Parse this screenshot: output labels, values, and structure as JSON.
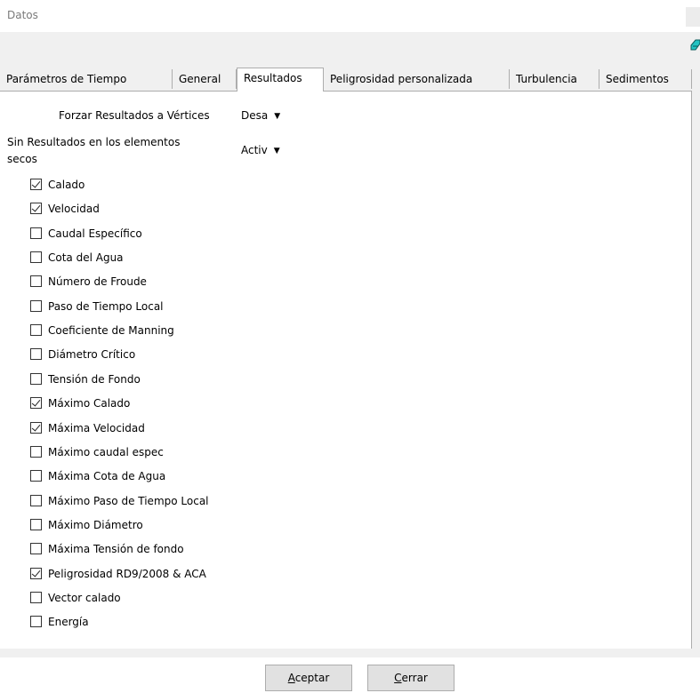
{
  "window": {
    "title": "Datos"
  },
  "tabs": [
    {
      "label": "Parámetros de Tiempo",
      "active": false
    },
    {
      "label": "General",
      "active": false
    },
    {
      "label": "Resultados",
      "active": true
    },
    {
      "label": "Peligrosidad personalizada",
      "active": false
    },
    {
      "label": "Turbulencia",
      "active": false
    },
    {
      "label": "Sedimentos",
      "active": false
    }
  ],
  "settings": {
    "force_label": "Forzar Resultados a Vértices",
    "force_value": "Desa",
    "dry_label_line1": "Sin Resultados en los elementos",
    "dry_label_line2": "secos",
    "dry_value": "Activ"
  },
  "results": [
    {
      "label": "Calado",
      "checked": true
    },
    {
      "label": "Velocidad",
      "checked": true
    },
    {
      "label": "Caudal Específico",
      "checked": false
    },
    {
      "label": "Cota del Agua",
      "checked": false
    },
    {
      "label": "Número de Froude",
      "checked": false
    },
    {
      "label": "Paso de Tiempo Local",
      "checked": false
    },
    {
      "label": "Coeficiente de Manning",
      "checked": false
    },
    {
      "label": "Diámetro Crítico",
      "checked": false
    },
    {
      "label": "Tensión de Fondo",
      "checked": false
    },
    {
      "label": "Máximo Calado",
      "checked": true
    },
    {
      "label": "Máxima Velocidad",
      "checked": true
    },
    {
      "label": "Máximo caudal espec",
      "checked": false
    },
    {
      "label": "Máxima Cota de Agua",
      "checked": false
    },
    {
      "label": "Máximo Paso de Tiempo Local",
      "checked": false
    },
    {
      "label": "Máximo Diámetro",
      "checked": false
    },
    {
      "label": "Máxima Tensión de fondo",
      "checked": false
    },
    {
      "label": "Peligrosidad RD9/2008 & ACA",
      "checked": true
    },
    {
      "label": "Vector calado",
      "checked": false
    },
    {
      "label": "Energía",
      "checked": false
    }
  ],
  "buttons": {
    "accept_mnemonic": "A",
    "accept_rest": "ceptar",
    "close_mnemonic": "C",
    "close_rest": "errar"
  },
  "icons": {
    "toolbar": "eraser-icon",
    "dropdown": "chevron-down-icon"
  }
}
